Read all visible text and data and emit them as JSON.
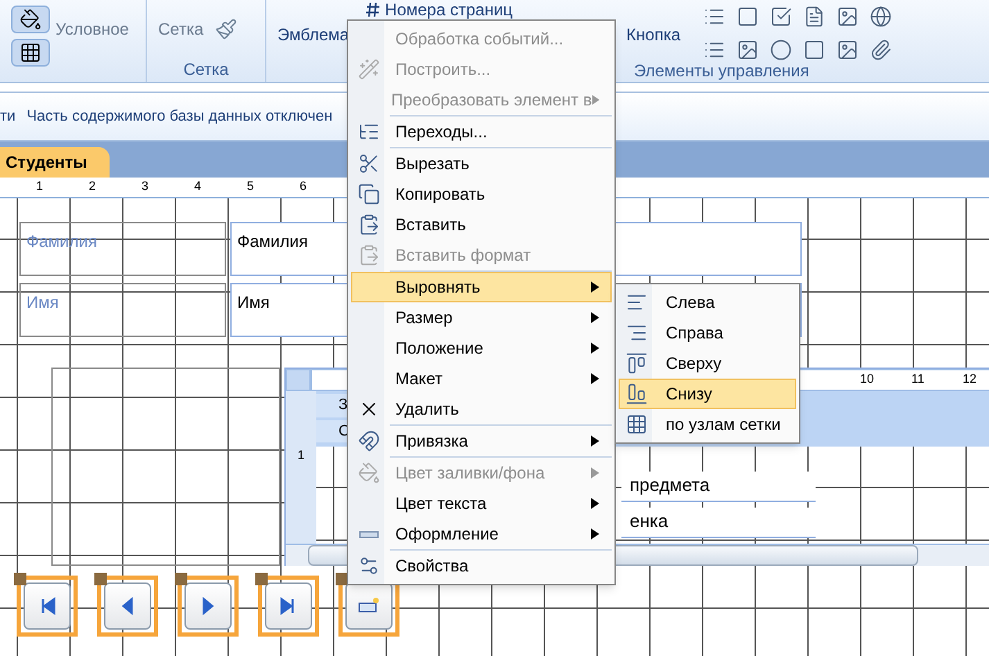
{
  "ribbon": {
    "buttons": [
      "Условное",
      "Сетка",
      "Эмблема",
      "Номера страниц",
      "Кнопка"
    ],
    "groups": [
      "Сетка",
      "Элементы управления"
    ]
  },
  "message_bar": {
    "prefix": "ти",
    "text": "Часть содержимого базы данных отключен"
  },
  "tabs": [
    {
      "label": "Студенты",
      "selected": true
    }
  ],
  "ruler": [
    "1",
    "2",
    "3",
    "4",
    "5",
    "6"
  ],
  "form": {
    "labels": [
      "Фамилия",
      "Имя"
    ],
    "fields": [
      "Фамилия",
      "Имя"
    ]
  },
  "subform": {
    "ruler": [
      "10",
      "11",
      "12"
    ],
    "side_ruler": "1",
    "header_labels": [
      "З",
      "С"
    ],
    "fields": [
      "предмета",
      "енка"
    ]
  },
  "nav_buttons": [
    {
      "kind": "first"
    },
    {
      "kind": "prev"
    },
    {
      "kind": "next"
    },
    {
      "kind": "last"
    },
    {
      "kind": "new"
    }
  ],
  "context_menu": [
    {
      "label": "Обработка событий...",
      "disabled": true,
      "submenu": false,
      "selected": false,
      "separator_before": false
    },
    {
      "label": "Построить...",
      "disabled": true,
      "submenu": false,
      "selected": false,
      "separator_before": false
    },
    {
      "label": "Преобразовать элемент в",
      "disabled": true,
      "submenu": true,
      "selected": false,
      "separator_before": false
    },
    {
      "label": "Переходы...",
      "disabled": false,
      "submenu": false,
      "selected": false,
      "separator_before": true
    },
    {
      "label": "Вырезать",
      "disabled": false,
      "submenu": false,
      "selected": false,
      "separator_before": true
    },
    {
      "label": "Копировать",
      "disabled": false,
      "submenu": false,
      "selected": false,
      "separator_before": false
    },
    {
      "label": "Вставить",
      "disabled": false,
      "submenu": false,
      "selected": false,
      "separator_before": false
    },
    {
      "label": "Вставить формат",
      "disabled": true,
      "submenu": false,
      "selected": false,
      "separator_before": false
    },
    {
      "label": "Выровнять",
      "disabled": false,
      "submenu": true,
      "selected": true,
      "separator_before": true
    },
    {
      "label": "Размер",
      "disabled": false,
      "submenu": true,
      "selected": false,
      "separator_before": false
    },
    {
      "label": "Положение",
      "disabled": false,
      "submenu": true,
      "selected": false,
      "separator_before": false
    },
    {
      "label": "Макет",
      "disabled": false,
      "submenu": true,
      "selected": false,
      "separator_before": false
    },
    {
      "label": "Удалить",
      "disabled": false,
      "submenu": false,
      "selected": false,
      "separator_before": false
    },
    {
      "label": "Привязка",
      "disabled": false,
      "submenu": true,
      "selected": false,
      "separator_before": true
    },
    {
      "label": "Цвет заливки/фона",
      "disabled": true,
      "submenu": true,
      "selected": false,
      "separator_before": true
    },
    {
      "label": "Цвет текста",
      "disabled": false,
      "submenu": true,
      "selected": false,
      "separator_before": false
    },
    {
      "label": "Оформление",
      "disabled": false,
      "submenu": true,
      "selected": false,
      "separator_before": false
    },
    {
      "label": "Свойства",
      "disabled": false,
      "submenu": false,
      "selected": false,
      "separator_before": true
    }
  ],
  "align_submenu": [
    {
      "label": "Слева",
      "selected": false
    },
    {
      "label": "Справа",
      "selected": false
    },
    {
      "label": "Сверху",
      "selected": false
    },
    {
      "label": "Снизу",
      "selected": true
    },
    {
      "label": "по узлам сетки",
      "selected": false
    }
  ]
}
